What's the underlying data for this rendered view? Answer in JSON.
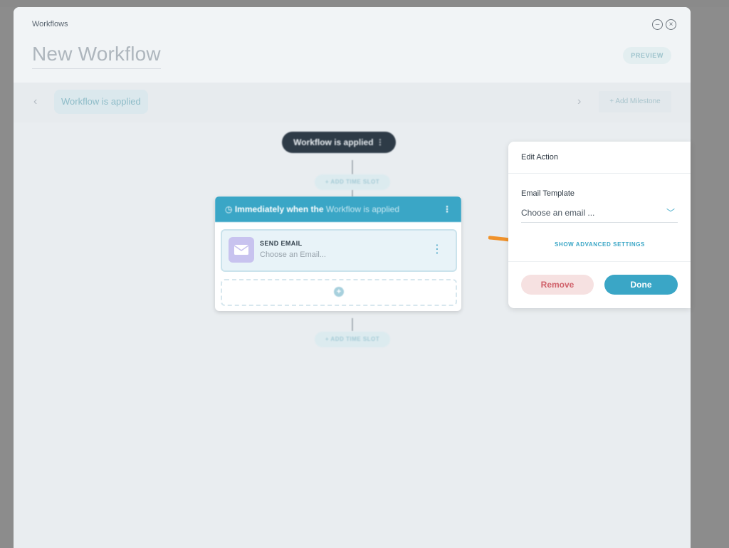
{
  "header": {
    "breadcrumb": "Workflows",
    "title": "New Workflow",
    "preview_label": "PREVIEW"
  },
  "milestones": {
    "current": "Workflow is applied",
    "add_label": "+ Add Milestone"
  },
  "flow": {
    "trigger_label": "Workflow is applied",
    "time_slot_label": "+ ADD TIME SLOT",
    "card_header_bold": "Immediately when the",
    "card_header_light": "Workflow is applied",
    "action_title": "SEND EMAIL",
    "action_subtitle": "Choose an Email..."
  },
  "edit_action": {
    "title": "Edit Action",
    "field_label": "Email Template",
    "field_placeholder": "Choose an email ...",
    "advanced_link": "SHOW ADVANCED SETTINGS",
    "remove_label": "Remove",
    "done_label": "Done"
  },
  "colors": {
    "accent": "#3aa6c6",
    "arrow": "#f0922b",
    "danger": "#d0616a"
  }
}
